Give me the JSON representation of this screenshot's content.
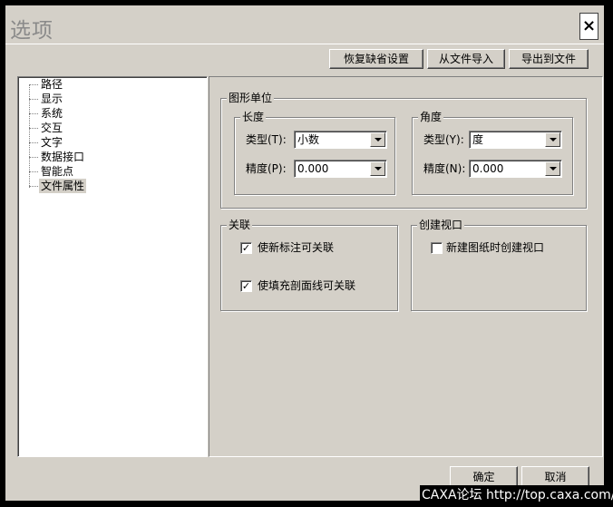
{
  "window": {
    "title": "选项",
    "close_glyph": "×"
  },
  "toolbar": {
    "restore_defaults": "恢复缺省设置",
    "import_from_file": "从文件导入",
    "export_to_file": "导出到文件"
  },
  "tree": {
    "items": [
      {
        "label": "路径",
        "selected": false
      },
      {
        "label": "显示",
        "selected": false
      },
      {
        "label": "系统",
        "selected": false
      },
      {
        "label": "交互",
        "selected": false
      },
      {
        "label": "文字",
        "selected": false
      },
      {
        "label": "数据接口",
        "selected": false
      },
      {
        "label": "智能点",
        "selected": false
      },
      {
        "label": "文件属性",
        "selected": true
      }
    ]
  },
  "units": {
    "title": "图形单位",
    "length": {
      "title": "长度",
      "type_label": "类型(T):",
      "type_value": "小数",
      "precision_label": "精度(P):",
      "precision_value": "0.000"
    },
    "angle": {
      "title": "角度",
      "type_label": "类型(Y):",
      "type_value": "度",
      "precision_label": "精度(N):",
      "precision_value": "0.000"
    }
  },
  "association": {
    "title": "关联",
    "new_dimension_label": "使新标注可关联",
    "new_dimension_checked": true,
    "hatch_label": "使填充剖面线可关联",
    "hatch_checked": true
  },
  "viewport": {
    "title": "创建视口",
    "new_sheet_label": "新建图纸时创建视口",
    "new_sheet_checked": false
  },
  "footer": {
    "ok": "确定",
    "cancel": "取消"
  },
  "watermark": "CAXA论坛 http://top.caxa.com/",
  "colors": {
    "dialog_bg": "#d4d0c8",
    "border_dark": "#808080",
    "frame": "#000000"
  }
}
